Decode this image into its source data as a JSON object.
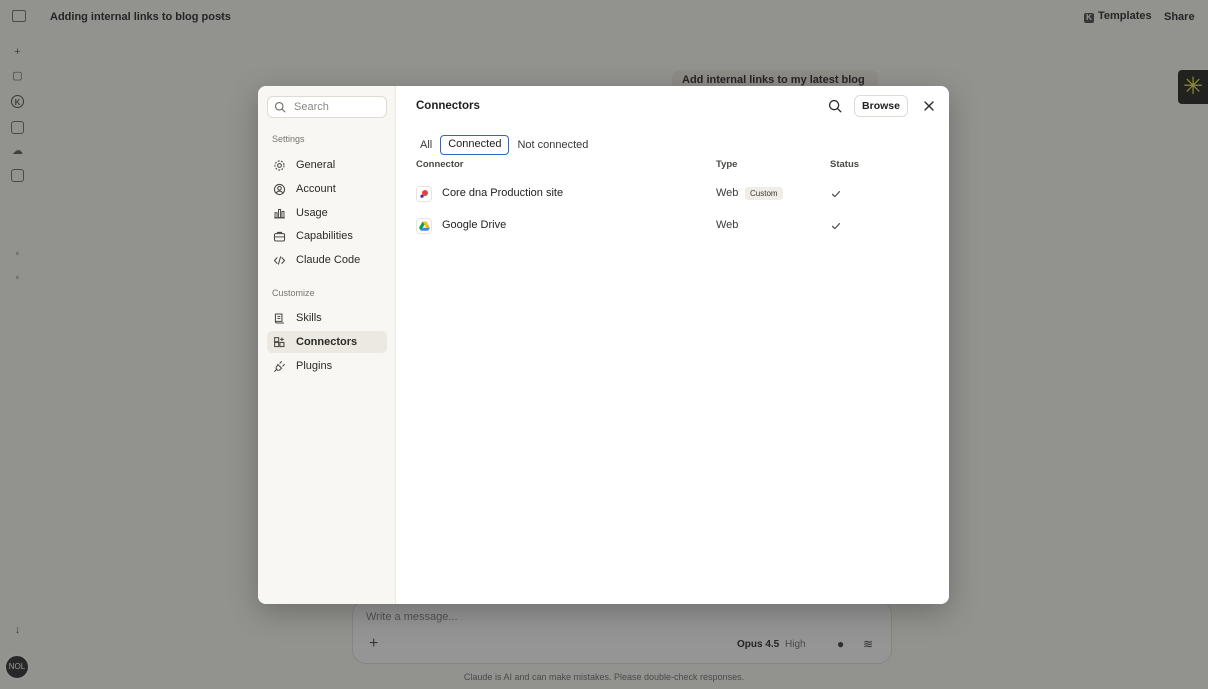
{
  "app": {
    "chat_title": "Adding internal links to blog posts",
    "templates_label": "Templates",
    "templates_icon_letter": "K",
    "share_label": "Share",
    "user_message": "Add internal links to my latest blog",
    "rail_k_letter": "K",
    "avatar_text": "NOL",
    "composer_placeholder": "Write a message...",
    "model_label": "Opus 4.5",
    "effort_label": "High",
    "disclaimer": "Claude is AI and can make mistakes. Please double-check responses.",
    "accent_color": "#e8ef5a"
  },
  "modal": {
    "search_placeholder": "Search",
    "nav": {
      "settings_heading": "Settings",
      "settings_items": [
        {
          "label": "General",
          "icon": "gear-icon"
        },
        {
          "label": "Account",
          "icon": "user-circle-icon"
        },
        {
          "label": "Usage",
          "icon": "bar-chart-icon"
        },
        {
          "label": "Capabilities",
          "icon": "briefcase-icon"
        },
        {
          "label": "Claude Code",
          "icon": "code-icon"
        }
      ],
      "customize_heading": "Customize",
      "customize_items": [
        {
          "label": "Skills",
          "icon": "skills-icon"
        },
        {
          "label": "Connectors",
          "icon": "connectors-icon",
          "active": true
        },
        {
          "label": "Plugins",
          "icon": "plug-icon"
        }
      ]
    },
    "content": {
      "title": "Connectors",
      "browse_label": "Browse",
      "tabs": [
        {
          "label": "All",
          "active": false
        },
        {
          "label": "Connected",
          "active": true
        },
        {
          "label": "Not connected",
          "active": false
        }
      ],
      "columns": {
        "connector": "Connector",
        "type": "Type",
        "status": "Status"
      },
      "rows": [
        {
          "name": "Core dna Production site",
          "type": "Web",
          "badge": "Custom",
          "status": "connected",
          "logo": "core-dna-logo-icon"
        },
        {
          "name": "Google Drive",
          "type": "Web",
          "badge": "",
          "status": "connected",
          "logo": "google-drive-logo-icon"
        }
      ],
      "active_tab_color": "#2b68c8"
    }
  }
}
